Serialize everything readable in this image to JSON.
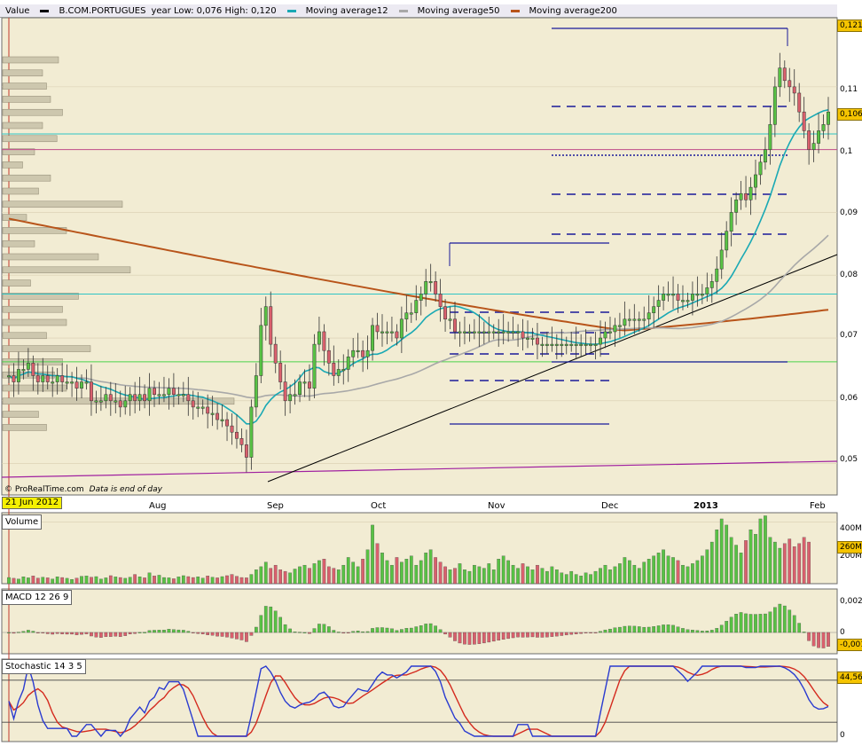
{
  "header": {
    "value_label": "Value",
    "instrument": "B.COM.PORTUGUES",
    "range_text": "year Low: 0,076 High: 0,120",
    "legend": [
      {
        "label": "Moving average12",
        "color": "#1aa9b4"
      },
      {
        "label": "Moving average50",
        "color": "#a8a8a8"
      },
      {
        "label": "Moving average200",
        "color": "#b8541a"
      }
    ]
  },
  "credit": {
    "brand": "© ProRealTime.com",
    "note": "Data is end of day"
  },
  "start_date": "21 Jun 2012",
  "panels": {
    "volume": "Volume",
    "macd": "MACD 12 26 9",
    "stochastic": "Stochastic 14 3 5"
  },
  "colors": {
    "background": "#f2ecd3",
    "up": "#58c244",
    "down": "#d9606d",
    "ma12": "#1aa9b4",
    "ma50": "#a8a8a8",
    "ma200": "#b8541a",
    "stoch_k": "#2a3bd0",
    "stoch_d": "#d42a1e"
  },
  "chart_data": [
    {
      "type": "candlestick",
      "x_ticks": [
        "Aug",
        "Sep",
        "Oct",
        "Nov",
        "Dec",
        "2013",
        "Feb"
      ],
      "y_ticks": [
        "0,05",
        "0,06",
        "0,07",
        "0,08",
        "0,09",
        "0,1",
        "0,11"
      ],
      "ylim": [
        0.045,
        0.121
      ],
      "last_value": "0,106",
      "high_marker": "0,121",
      "close": [
        0.064,
        0.063,
        0.065,
        0.065,
        0.066,
        0.064,
        0.063,
        0.064,
        0.063,
        0.063,
        0.064,
        0.063,
        0.063,
        0.063,
        0.062,
        0.063,
        0.063,
        0.06,
        0.06,
        0.06,
        0.061,
        0.06,
        0.06,
        0.059,
        0.06,
        0.061,
        0.06,
        0.061,
        0.06,
        0.062,
        0.061,
        0.061,
        0.061,
        0.062,
        0.061,
        0.061,
        0.061,
        0.06,
        0.059,
        0.059,
        0.059,
        0.058,
        0.058,
        0.057,
        0.057,
        0.056,
        0.055,
        0.054,
        0.053,
        0.051,
        0.059,
        0.064,
        0.072,
        0.075,
        0.069,
        0.066,
        0.063,
        0.06,
        0.061,
        0.061,
        0.063,
        0.063,
        0.062,
        0.069,
        0.071,
        0.068,
        0.066,
        0.064,
        0.065,
        0.065,
        0.067,
        0.068,
        0.068,
        0.067,
        0.068,
        0.072,
        0.071,
        0.071,
        0.071,
        0.071,
        0.07,
        0.073,
        0.074,
        0.074,
        0.076,
        0.077,
        0.079,
        0.079,
        0.077,
        0.075,
        0.073,
        0.073,
        0.071,
        0.071,
        0.071,
        0.071,
        0.071,
        0.071,
        0.071,
        0.071,
        0.071,
        0.071,
        0.071,
        0.071,
        0.071,
        0.071,
        0.07,
        0.07,
        0.07,
        0.069,
        0.069,
        0.069,
        0.069,
        0.069,
        0.069,
        0.069,
        0.069,
        0.069,
        0.069,
        0.069,
        0.069,
        0.069,
        0.07,
        0.071,
        0.071,
        0.072,
        0.072,
        0.073,
        0.073,
        0.073,
        0.073,
        0.073,
        0.074,
        0.075,
        0.076,
        0.077,
        0.077,
        0.077,
        0.076,
        0.076,
        0.076,
        0.077,
        0.077,
        0.077,
        0.078,
        0.079,
        0.081,
        0.084,
        0.087,
        0.09,
        0.092,
        0.093,
        0.092,
        0.094,
        0.096,
        0.098,
        0.1,
        0.104,
        0.11,
        0.113,
        0.111,
        0.11,
        0.109,
        0.106,
        0.103,
        0.1,
        0.101,
        0.103,
        0.104,
        0.106
      ],
      "volume": [
        40,
        35,
        30,
        45,
        38,
        50,
        36,
        42,
        38,
        30,
        45,
        40,
        35,
        28,
        36,
        48,
        50,
        42,
        46,
        30,
        38,
        52,
        44,
        40,
        35,
        42,
        60,
        45,
        38,
        70,
        50,
        55,
        40,
        38,
        32,
        44,
        52,
        46,
        40,
        45,
        36,
        50,
        42,
        38,
        46,
        52,
        60,
        48,
        40,
        38,
        60,
        90,
        110,
        140,
        100,
        120,
        90,
        80,
        70,
        95,
        110,
        120,
        100,
        130,
        150,
        160,
        110,
        100,
        90,
        120,
        170,
        140,
        110,
        160,
        220,
        380,
        260,
        200,
        150,
        120,
        170,
        140,
        160,
        180,
        120,
        150,
        200,
        220,
        170,
        140,
        110,
        90,
        100,
        130,
        90,
        80,
        120,
        110,
        100,
        130,
        90,
        160,
        180,
        150,
        120,
        100,
        130,
        110,
        90,
        120,
        100,
        80,
        110,
        90,
        70,
        60,
        80,
        60,
        50,
        70,
        60,
        80,
        100,
        120,
        90,
        110,
        130,
        170,
        150,
        120,
        100,
        140,
        160,
        180,
        200,
        220,
        180,
        170,
        150,
        120,
        110,
        130,
        150,
        180,
        220,
        270,
        350,
        420,
        380,
        300,
        250,
        200,
        280,
        350,
        320,
        420,
        440,
        300,
        270,
        230,
        260,
        290,
        240,
        260,
        300,
        270
      ],
      "volume_ticks": [
        "400M",
        "200M"
      ],
      "volume_last": "260M",
      "volume_max": 460,
      "macd_ticks": [
        "0,002",
        "0"
      ],
      "macd_last": "-0,001",
      "stochastic_ticks": [
        "0"
      ],
      "stochastic_last": "44,56"
    }
  ]
}
